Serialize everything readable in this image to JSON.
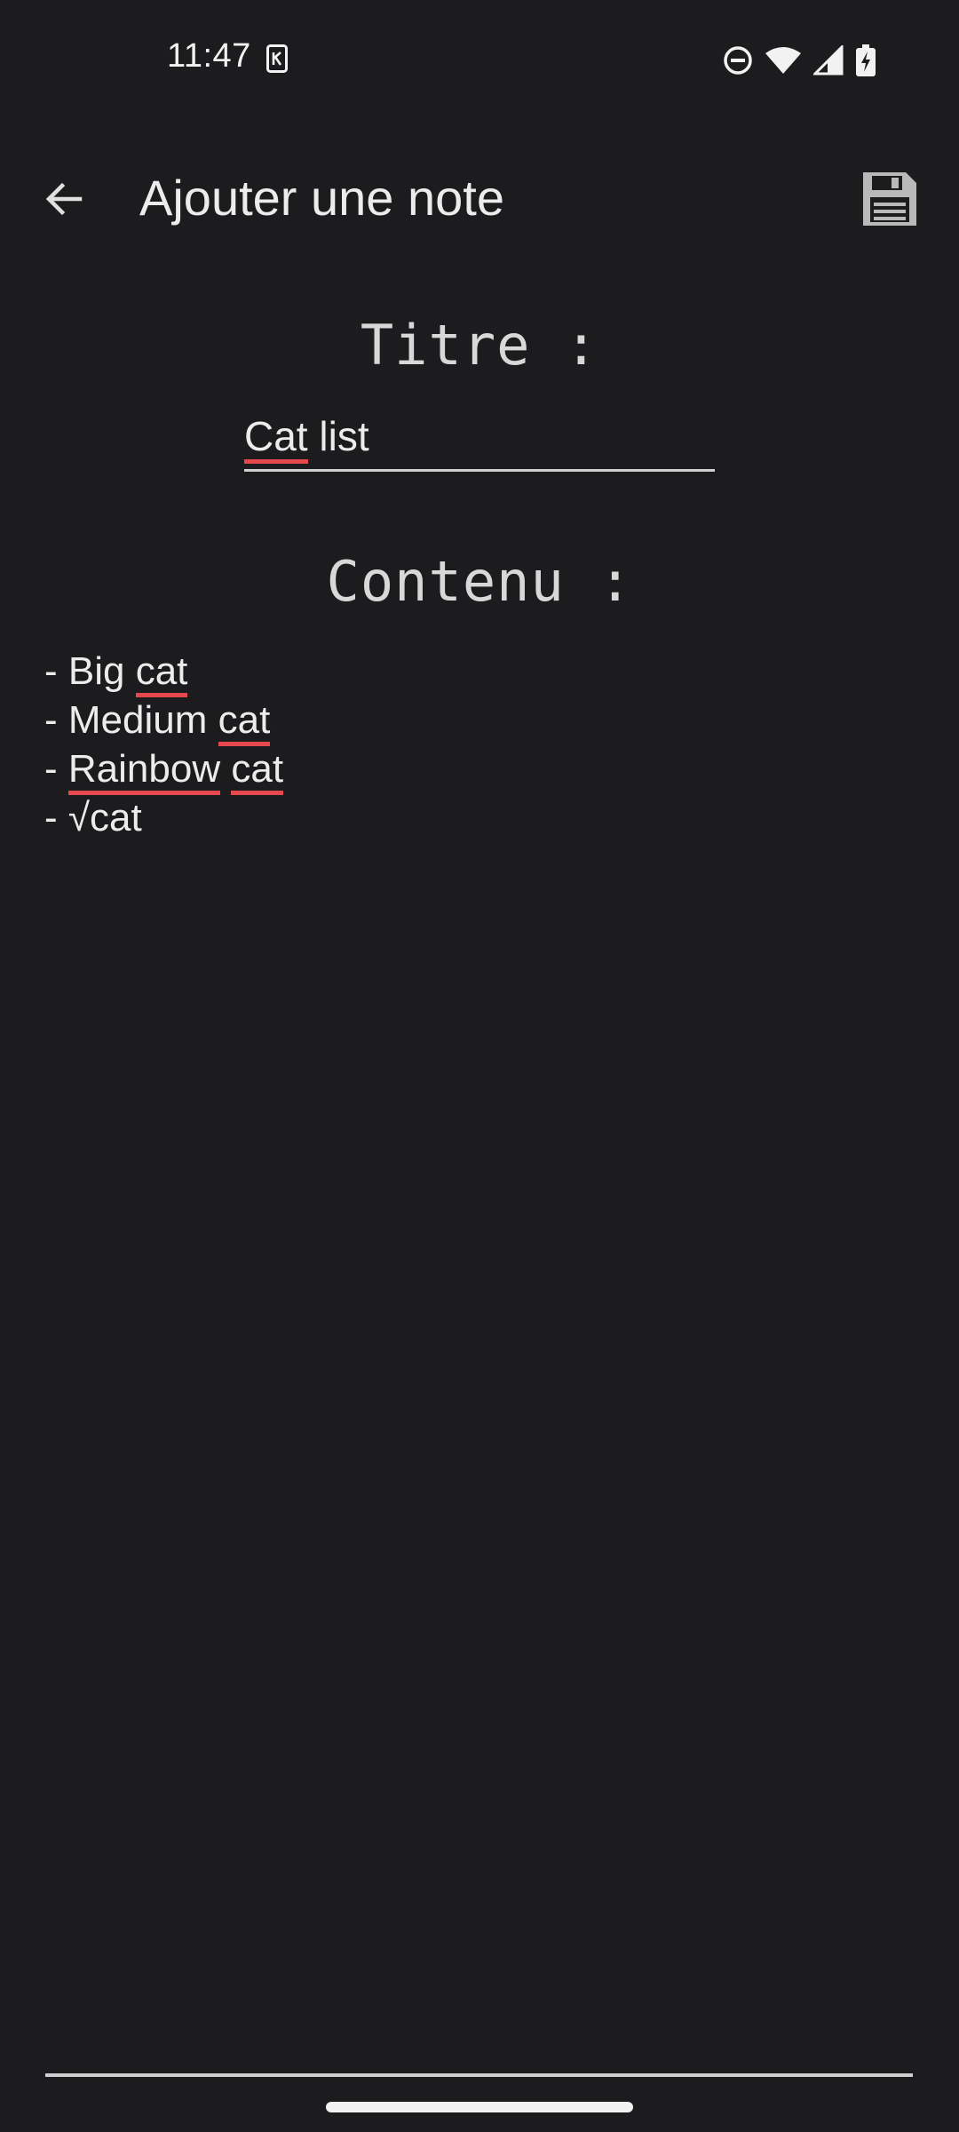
{
  "status_bar": {
    "time": "11:47",
    "icons": [
      "notification-app-icon",
      "do-not-disturb-icon",
      "wifi-icon",
      "cell-signal-icon",
      "battery-charging-icon"
    ]
  },
  "app_bar": {
    "back_icon": "arrow-left-icon",
    "title": "Ajouter une note",
    "save_icon": "floppy-disk-icon"
  },
  "form": {
    "title_label": "Titre :",
    "title_value_word1": "Cat",
    "title_value_rest": " list",
    "content_label": "Contenu :",
    "content_lines": [
      {
        "prefix": "- Big ",
        "word": "cat",
        "suffix": ""
      },
      {
        "prefix": "- Medium ",
        "word": "cat",
        "suffix": ""
      },
      {
        "prefix": "- ",
        "word": "Rainbow",
        "mid": " ",
        "word2": "cat",
        "suffix": ""
      },
      {
        "prefix": "- √cat",
        "word": "",
        "suffix": ""
      }
    ]
  },
  "colors": {
    "background": "#1c1c1e",
    "text": "#ececec",
    "spellcheck": "#e5484d"
  }
}
